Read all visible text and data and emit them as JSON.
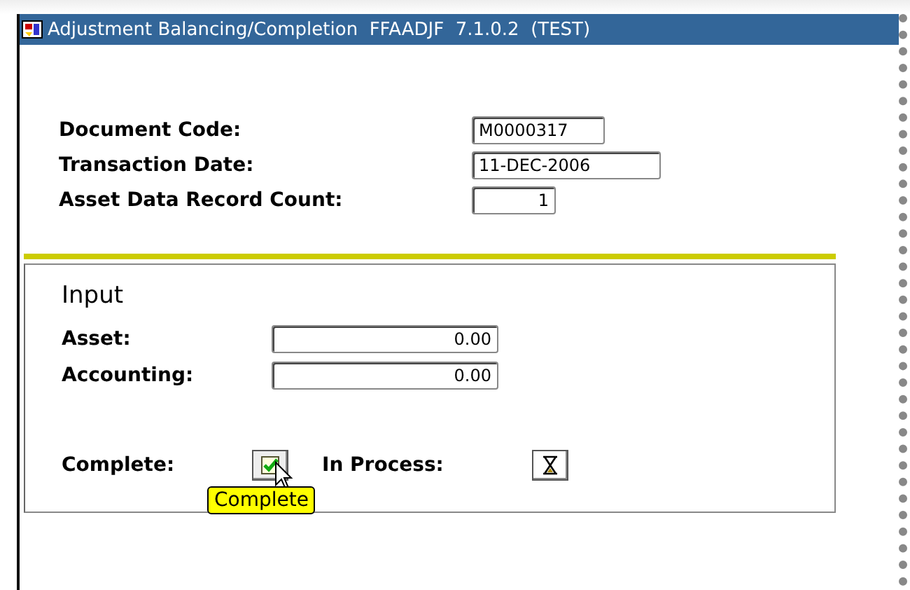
{
  "window": {
    "title": "Adjustment Balancing/Completion  FFAADJF  7.1.0.2  (TEST)"
  },
  "header_fields": [
    {
      "label": "Document Code:",
      "value": "M0000317"
    },
    {
      "label": "Transaction Date:",
      "value": "11-DEC-2006"
    },
    {
      "label": "Asset Data Record Count:",
      "value": "1"
    }
  ],
  "input": {
    "title": "Input",
    "fields": [
      {
        "label": "Asset:",
        "value": "0.00"
      },
      {
        "label": "Accounting:",
        "value": "0.00"
      }
    ],
    "complete_label": "Complete:",
    "in_process_label": "In Process:",
    "tooltip": "Complete"
  }
}
